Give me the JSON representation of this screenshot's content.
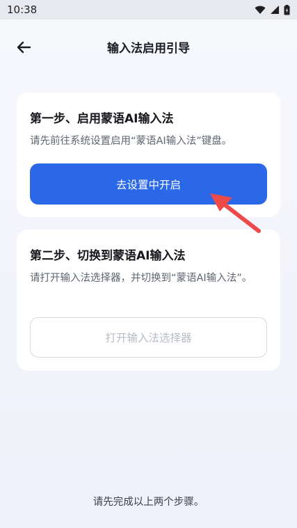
{
  "status_bar": {
    "time": "10:38",
    "icons": [
      "wifi-icon",
      "signal-icon",
      "battery-icon"
    ]
  },
  "header": {
    "title": "输入法启用引导",
    "back_icon": "arrow-left-icon"
  },
  "step1": {
    "title": "第一步、启用蒙语AI输入法",
    "description": "请先前往系统设置启用“蒙语AI输入法”键盘。",
    "button_label": "去设置中开启"
  },
  "step2": {
    "title": "第二步、切换到蒙语AI输入法",
    "description": "请打开输入法选择器，并切换到“蒙语AI输入法”。",
    "button_label": "打开输入法选择器"
  },
  "footer": {
    "note": "请先完成以上两个步骤。"
  },
  "colors": {
    "primary": "#2b68e8",
    "annotation_arrow": "#ef4a4a",
    "disabled_text": "#b7bcc5"
  }
}
